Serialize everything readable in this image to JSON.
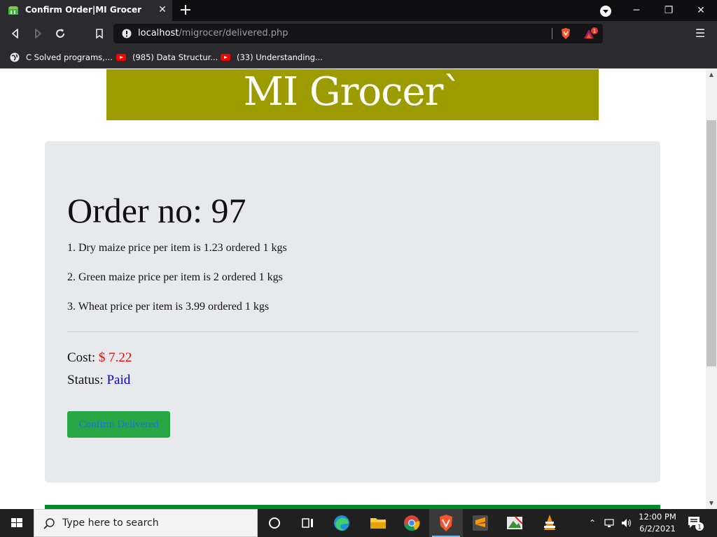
{
  "browser": {
    "tab_title": "Confirm Order|MI Grocer",
    "url_host": "localhost",
    "url_path": "/migrocer/delivered.php",
    "rewards_badge": "1",
    "bookmarks": [
      {
        "label": "C Solved programs,...",
        "icon": "globe-icon"
      },
      {
        "label": "(985) Data Structur...",
        "icon": "youtube-icon"
      },
      {
        "label": "(33) Understanding...",
        "icon": "youtube-icon"
      }
    ]
  },
  "page": {
    "banner_title": "MI Grocer`",
    "order_title": "Order no: 97",
    "items": [
      "1. Dry maize price per item is 1.23 ordered 1 kgs",
      "2. Green maize price per item is 2 ordered 1 kgs",
      "3. Wheat price per item is 3.99 ordered 1 kgs"
    ],
    "cost_label": "Cost:",
    "cost_value": "$ 7.22",
    "status_label": "Status:",
    "status_value": "Paid",
    "confirm_button": "Confirm Delivered"
  },
  "colors": {
    "banner_bg": "#9c9c00",
    "card_bg": "#e7e9ec",
    "cost_color": "#ff0000",
    "status_color": "#0000dd",
    "button_bg": "#28a745",
    "footer_strip": "#008a2b"
  },
  "taskbar": {
    "search_placeholder": "Type here to search",
    "time": "12:00 PM",
    "date": "6/2/2021",
    "notification_count": "1"
  }
}
